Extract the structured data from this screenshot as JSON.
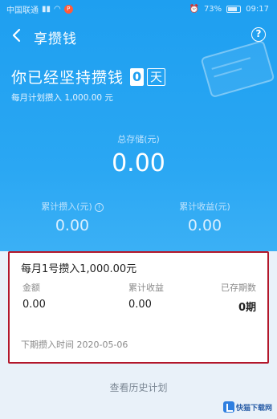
{
  "status_bar": {
    "carrier": "中国联通",
    "notification_badge": "P",
    "battery": "73%",
    "time": "09:17"
  },
  "nav": {
    "title": "享攒钱"
  },
  "header": {
    "persist_text": "你已经坚持攒钱",
    "days": "0",
    "day_unit": "天",
    "monthly_plan": "每月计划攒入 1,000.00 元"
  },
  "totals": {
    "total_label": "总存储(元)",
    "total_value": "0.00",
    "left_label": "累计攒入(元)",
    "left_value": "0.00",
    "right_label": "累计收益(元)",
    "right_value": "0.00"
  },
  "plan_card": {
    "title": "每月1号攒入1,000.00元",
    "col1_label": "金额",
    "col2_label": "累计收益",
    "col3_label": "已存期数",
    "col1_value": "0.00",
    "col2_value": "0.00",
    "col3_value": "0期",
    "next_date": "下期攒入时间 2020-05-06"
  },
  "history_link": "查看历史计划",
  "watermark": "快猫下载网",
  "colors": {
    "accent": "#1e9ff0",
    "highlight_border": "#b3172b"
  }
}
